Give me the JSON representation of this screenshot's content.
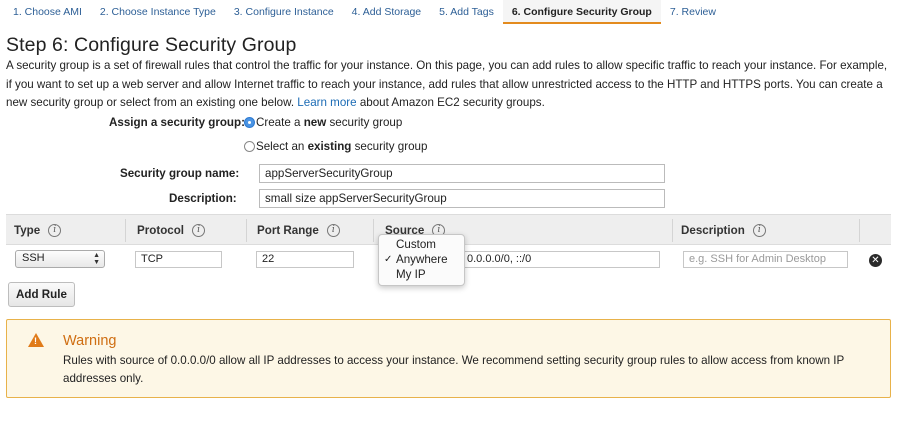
{
  "wizard": {
    "tabs": [
      {
        "label": "1. Choose AMI",
        "active": false
      },
      {
        "label": "2. Choose Instance Type",
        "active": false
      },
      {
        "label": "3. Configure Instance",
        "active": false
      },
      {
        "label": "4. Add Storage",
        "active": false
      },
      {
        "label": "5. Add Tags",
        "active": false
      },
      {
        "label": "6. Configure Security Group",
        "active": true
      },
      {
        "label": "7. Review",
        "active": false
      }
    ]
  },
  "page": {
    "title": "Step 6: Configure Security Group",
    "intro_text": "A security group is a set of firewall rules that control the traffic for your instance. On this page, you can add rules to allow specific traffic to reach your instance. For example, if you want to set up a web server and allow Internet traffic to reach your instance, add rules that allow unrestricted access to the HTTP and HTTPS ports. You can create a new security group or select from an existing one below.",
    "learn_more_link": "Learn more",
    "intro_suffix": "about Amazon EC2 security groups."
  },
  "assign": {
    "label": "Assign a security group:",
    "option_create_prefix": "Create a ",
    "option_create_bold": "new",
    "option_create_suffix": " security group",
    "option_select_prefix": "Select an ",
    "option_select_bold": "existing",
    "option_select_suffix": " security group",
    "selected": "create"
  },
  "fields": {
    "name_label": "Security group name:",
    "name_value": "appServerSecurityGroup",
    "description_label": "Description:",
    "description_value": "small size appServerSecurityGroup"
  },
  "rules_table": {
    "columns": [
      "Type",
      "Protocol",
      "Port Range",
      "Source",
      "Description"
    ],
    "rows": [
      {
        "type": "SSH",
        "protocol": "TCP",
        "port_range": "22",
        "source_cidr": "0.0.0.0/0, ::/0",
        "description_placeholder": "e.g. SSH for Admin Desktop"
      }
    ],
    "source_dropdown": {
      "options": [
        "Custom",
        "Anywhere",
        "My IP"
      ],
      "selected": "Anywhere"
    },
    "add_rule_label": "Add Rule"
  },
  "warning": {
    "title": "Warning",
    "body": "Rules with source of 0.0.0.0/0 allow all IP addresses to access your instance. We recommend setting security group rules to allow access from known IP addresses only."
  },
  "colors": {
    "link": "#1b6bb5",
    "active_tab_underline": "#e38b1e",
    "warning_border": "#e8b24a",
    "warning_background": "#fdf7e6",
    "warning_title": "#cf6e12",
    "radio_selected": "#4a94e4"
  },
  "icons": {
    "info": "info-icon",
    "remove": "remove-rule-icon",
    "warning": "warning-triangle-icon",
    "check": "checkmark-icon"
  }
}
